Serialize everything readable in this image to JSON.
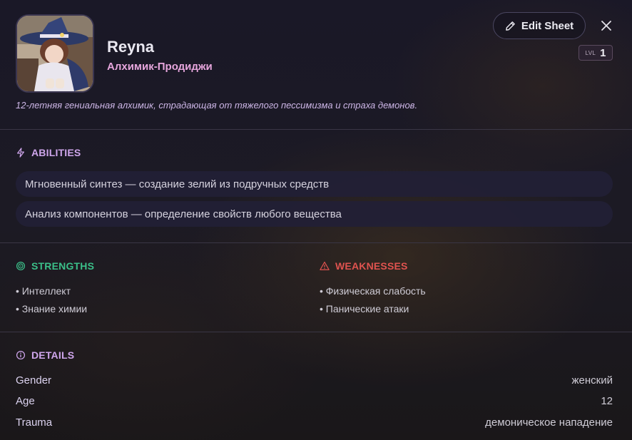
{
  "character": {
    "name": "Reyna",
    "title": "Алхимик-Продиджи",
    "description": "12-летняя гениальная алхимик, страдающая от тяжелого пессимизма и страха демонов.",
    "level_label": "LVL",
    "level": "1"
  },
  "header": {
    "edit_label": "Edit Sheet",
    "edit_icon": "pencil-icon",
    "close_icon": "close-icon"
  },
  "abilities": {
    "heading": "ABILITIES",
    "icon": "lightning-icon",
    "items": [
      "Мгновенный синтез — создание зелий из подручных средств",
      "Анализ компонентов — определение свойств любого вещества"
    ]
  },
  "strengths": {
    "heading": "STRENGTHS",
    "icon": "target-icon",
    "items": [
      "• Интеллект",
      "• Знание химии"
    ]
  },
  "weaknesses": {
    "heading": "WEAKNESSES",
    "icon": "warning-icon",
    "items": [
      "• Физическая слабость",
      "• Панические атаки"
    ]
  },
  "details": {
    "heading": "DETAILS",
    "icon": "info-icon",
    "rows": [
      {
        "label": "Gender",
        "value": "женский"
      },
      {
        "label": "Age",
        "value": "12"
      },
      {
        "label": "Trauma",
        "value": "демоническое нападение"
      }
    ]
  },
  "colors": {
    "accent_purple": "#cfa6ec",
    "title_pink": "#e7a6dd",
    "strengths_green": "#3bbf89",
    "weaknesses_red": "#e0534f"
  }
}
